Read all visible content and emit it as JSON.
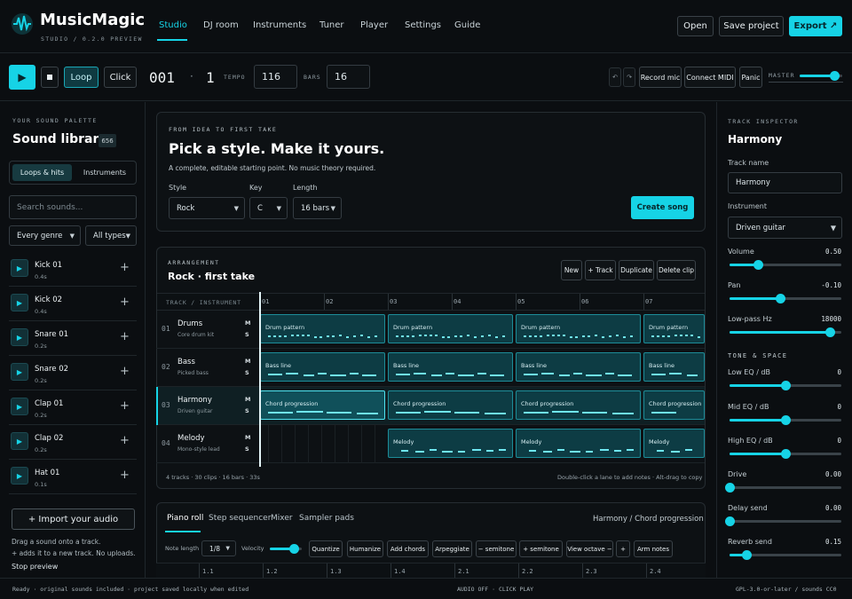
{
  "app": {
    "name": "MusicMagic",
    "subtitle": "STUDIO / 0.2.0 PREVIEW"
  },
  "nav": {
    "tabs": [
      "Studio",
      "DJ room",
      "Instruments",
      "Tuner",
      "Player",
      "Settings",
      "Guide"
    ],
    "active": "Studio",
    "open_label": "Open",
    "save_label": "Save project",
    "export_label": "Export ↗"
  },
  "transport": {
    "loop_label": "Loop",
    "click_label": "Click",
    "bar": "001",
    "beat": "1",
    "tempo_label": "TEMPO",
    "tempo_value": "116",
    "bars_label": "BARS",
    "bars_value": "16",
    "undo_icon": "undo-icon",
    "redo_icon": "redo-icon",
    "record_mic_label": "Record mic",
    "connect_midi_label": "Connect MIDI",
    "panic_label": "Panic",
    "master_label": "MASTER",
    "master_level": 0.82
  },
  "library": {
    "eyebrow": "YOUR SOUND PALETTE",
    "title": "Sound library",
    "count": "656",
    "tab_loops": "Loops & hits",
    "tab_instruments": "Instruments",
    "search_placeholder": "Search sounds...",
    "genre_filter": "Every genre",
    "type_filter": "All types",
    "sounds": [
      {
        "name": "Kick 01",
        "length": "0.4s"
      },
      {
        "name": "Kick 02",
        "length": "0.4s"
      },
      {
        "name": "Snare 01",
        "length": "0.2s"
      },
      {
        "name": "Snare 02",
        "length": "0.2s"
      },
      {
        "name": "Clap 01",
        "length": "0.2s"
      },
      {
        "name": "Clap 02",
        "length": "0.2s"
      },
      {
        "name": "Hat 01",
        "length": "0.1s"
      }
    ],
    "import_label": "+  Import your audio",
    "help_line1": "Drag a sound onto a track.",
    "help_line2": "+ adds it to a new track. No uploads.",
    "stop_preview": "Stop preview"
  },
  "starter": {
    "eyebrow": "FROM IDEA TO FIRST TAKE",
    "headline": "Pick a style. Make it yours.",
    "description": "A complete, editable starting point. No music theory required.",
    "style_label": "Style",
    "style_value": "Rock",
    "key_label": "Key",
    "key_value": "C",
    "length_label": "Length",
    "length_value": "16 bars",
    "create_label": "Create song"
  },
  "arrangement": {
    "eyebrow": "ARRANGEMENT",
    "title": "Rock · first take",
    "new_label": "New",
    "add_track_label": "+ Track",
    "duplicate_label": "Duplicate",
    "delete_label": "Delete clip",
    "header_label": "TRACK / INSTRUMENT",
    "bar_numbers": [
      "01",
      "02",
      "03",
      "04",
      "05",
      "06",
      "07"
    ],
    "tracks": [
      {
        "num": "01",
        "name": "Drums",
        "instrument": "Core drum kit",
        "clip": "Drum pattern"
      },
      {
        "num": "02",
        "name": "Bass",
        "instrument": "Picked bass",
        "clip": "Bass line"
      },
      {
        "num": "03",
        "name": "Harmony",
        "instrument": "Driven guitar",
        "clip": "Chord progression"
      },
      {
        "num": "04",
        "name": "Melody",
        "instrument": "Mono-style lead",
        "clip": "Melody"
      }
    ],
    "mute": "M",
    "solo": "S",
    "summary": "4 tracks · 30 clips · 16 bars · 33s",
    "hint": "Double-click a lane to add notes · Alt-drag to copy"
  },
  "editor": {
    "tabs": [
      "Piano roll",
      "Step sequencer",
      "Mixer",
      "Sampler pads"
    ],
    "active": "Piano roll",
    "context": "Harmony / Chord progression",
    "note_length_label": "Note length",
    "note_length_value": "1/8",
    "velocity_label": "Velocity",
    "velocity_level": 0.75,
    "tools": [
      "Quantize",
      "Humanize",
      "Add chords",
      "Arpeggiate",
      "− semitone",
      "+ semitone",
      "View octave −",
      "+",
      "Arm notes"
    ],
    "ruler": [
      "1.1",
      "1.2",
      "1.3",
      "1.4",
      "2.1",
      "2.2",
      "2.3",
      "2.4"
    ]
  },
  "inspector": {
    "eyebrow": "TRACK INSPECTOR",
    "title": "Harmony",
    "track_name_label": "Track name",
    "track_name_value": "Harmony",
    "instrument_label": "Instrument",
    "instrument_value": "Driven guitar",
    "tone_heading": "TONE & SPACE",
    "params": [
      {
        "label": "Volume",
        "value": "0.50",
        "level": 0.25
      },
      {
        "label": "Pan",
        "value": "-0.10",
        "level": 0.45
      },
      {
        "label": "Low-pass Hz",
        "value": "18000",
        "level": 0.9
      },
      {
        "label": "Low EQ / dB",
        "value": "0",
        "level": 0.5
      },
      {
        "label": "Mid EQ / dB",
        "value": "0",
        "level": 0.5
      },
      {
        "label": "High EQ / dB",
        "value": "0",
        "level": 0.5
      },
      {
        "label": "Drive",
        "value": "0.00",
        "level": 0.0
      },
      {
        "label": "Delay send",
        "value": "0.00",
        "level": 0.0
      },
      {
        "label": "Reverb send",
        "value": "0.15",
        "level": 0.15
      }
    ]
  },
  "status": {
    "left": "Ready · original sounds included · project saved locally when edited",
    "center": "AUDIO OFF · CLICK PLAY",
    "right": "GPL-3.0-or-later / sounds CC0"
  },
  "colors": {
    "accent": "#16d3e6",
    "background": "#0b0e11",
    "clip": "#0d3c44"
  }
}
